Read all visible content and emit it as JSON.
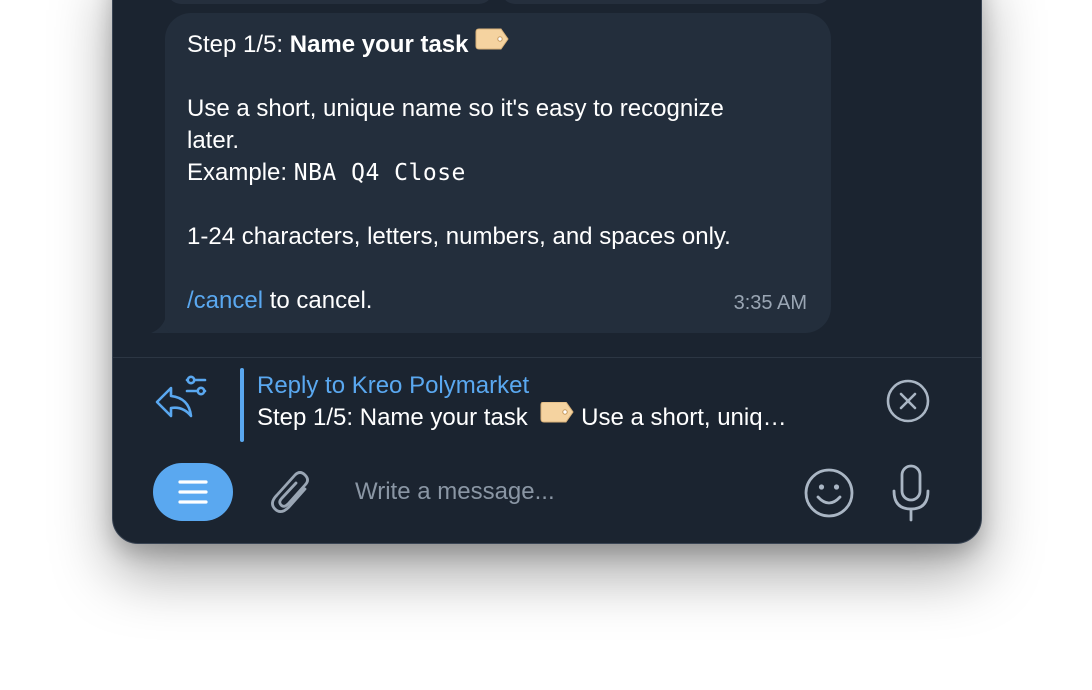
{
  "message": {
    "step_prefix": "Step 1/5: ",
    "step_title": "Name your task",
    "tag_emoji": "label-tag-emoji",
    "instruction": "Use a short, unique name so it's easy to recognize",
    "instruction_cont": "later.",
    "example_prefix": "Example: ",
    "example_value": "NBA Q4 Close",
    "rules": "1-24 characters, letters, numbers, and spaces only.",
    "cancel_command": "/cancel",
    "cancel_suffix": " to cancel.",
    "timestamp": "3:35 AM"
  },
  "reply": {
    "title": "Reply to Kreo Polymarket",
    "preview_start": "Step 1/5: Name your task ",
    "preview_end": " Use a short, uniq…"
  },
  "composer": {
    "placeholder": "Write a message..."
  },
  "icons": {
    "reply": "reply-arrow-settings-icon",
    "close": "close-circle-icon",
    "menu": "menu-icon",
    "attach": "paperclip-icon",
    "emoji": "smiley-icon",
    "mic": "microphone-icon"
  },
  "colors": {
    "background": "#1b2430",
    "bubble": "#232e3c",
    "accent": "#5aa8f0",
    "text": "#ffffff",
    "muted": "#9aa6b4"
  }
}
